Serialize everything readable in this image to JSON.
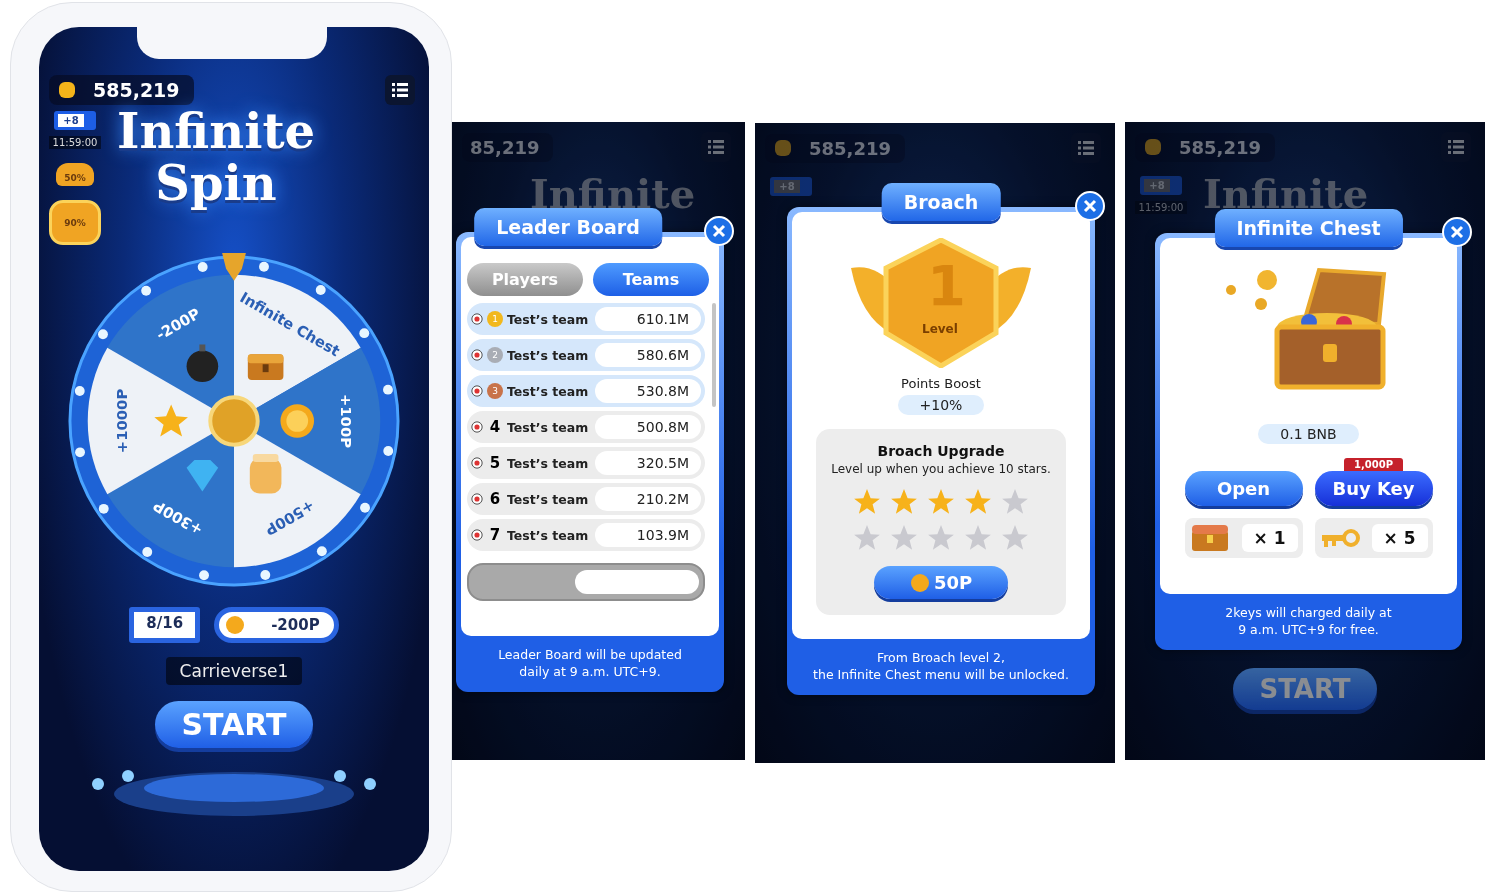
{
  "phone": {
    "balance": "585,219",
    "title_line_1": "Infinite",
    "title_line_2": "Spin",
    "video_bonus": "+8",
    "timer": "11:59:00",
    "team_bonus": "50%",
    "broach_bonus": "90%",
    "wheel": {
      "segments": [
        {
          "label": "-200P",
          "kind": "bomb"
        },
        {
          "label": "Infinite Chest",
          "kind": "chest"
        },
        {
          "label": "+100P",
          "kind": "coin"
        },
        {
          "label": "+500P",
          "kind": "jar"
        },
        {
          "label": "+300P",
          "kind": "diamond"
        },
        {
          "label": "+1000P",
          "kind": "star"
        }
      ]
    },
    "spins": "8/16",
    "cost": "-200P",
    "username": "Carrieverse1",
    "start": "START"
  },
  "leader_board": {
    "backdrop": {
      "balance": "85,219",
      "title": "Infinite"
    },
    "title": "Leader Board",
    "tabs": [
      {
        "label": "Players",
        "selected": false
      },
      {
        "label": "Teams",
        "selected": true
      }
    ],
    "rows": [
      {
        "kind": "medal",
        "rank": "1",
        "color": "#f2b81c",
        "team": "Test’s team",
        "score": "610.1M"
      },
      {
        "kind": "medal",
        "rank": "2",
        "color": "#a9adb5",
        "team": "Test’s team",
        "score": "580.6M"
      },
      {
        "kind": "medal",
        "rank": "3",
        "color": "#c8734a",
        "team": "Test’s team",
        "score": "530.8M"
      },
      {
        "kind": "number",
        "rank": "4",
        "team": "Test’s team",
        "score": "500.8M"
      },
      {
        "kind": "number",
        "rank": "5",
        "team": "Test’s team",
        "score": "320.5M"
      },
      {
        "kind": "number",
        "rank": "6",
        "team": "Test’s team",
        "score": "210.2M"
      },
      {
        "kind": "number",
        "rank": "7",
        "team": "Test’s team",
        "score": "103.9M"
      }
    ],
    "note_lines": [
      "Leader Board will be updated",
      "daily at 9 a.m. UTC+9."
    ]
  },
  "broach": {
    "backdrop": {
      "balance": "585,219",
      "video_bonus": "+8"
    },
    "title": "Broach",
    "level": "1",
    "level_label": "Level",
    "boost_label": "Points Boost",
    "boost_value": "+10%",
    "upgrade_title": "Broach Upgrade",
    "upgrade_text": "Level up when you achieve 10 stars.",
    "stars": 4,
    "upgrade_price": "50P",
    "note_lines": [
      "From Broach level 2,",
      "the Infinite Chest menu will be unlocked."
    ]
  },
  "infinite_chest": {
    "backdrop": {
      "balance": "585,219",
      "video_bonus": "+8",
      "timer": "11:59:00",
      "title": "Infinite",
      "start": "START"
    },
    "title": "Infinite Chest",
    "reward": "0.1 BNB",
    "key_price": "1,000P",
    "open_button": "Open",
    "buy_button": "Buy Key",
    "chest_count": "× 1",
    "key_count": "× 5",
    "note_lines": [
      "2keys will charged daily at",
      "9 a.m. UTC+9 for free."
    ]
  }
}
